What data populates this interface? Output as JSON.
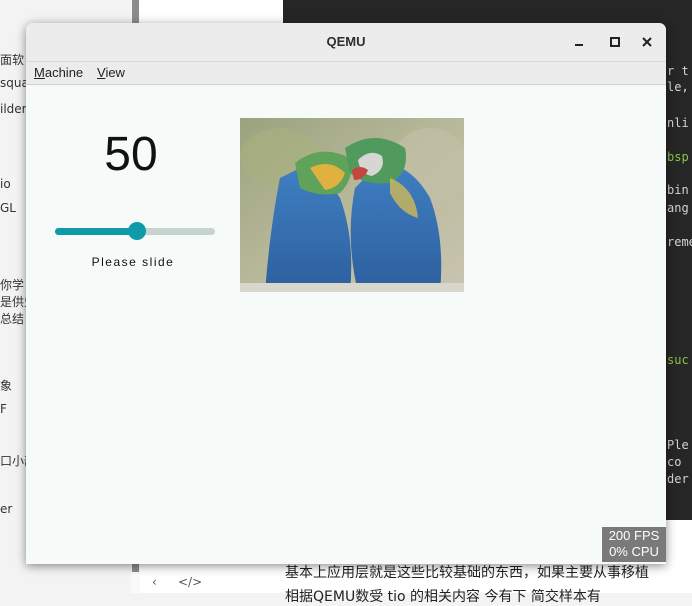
{
  "window": {
    "title": "QEMU",
    "menu": [
      {
        "label_accel": "M",
        "label_rest": "achine"
      },
      {
        "label_accel": "V",
        "label_rest": "iew"
      }
    ]
  },
  "app": {
    "slider_value": "50",
    "slider_fraction": 0.5,
    "slider_caption": "Please slide",
    "image_subject": "two-macaw-parrots"
  },
  "overlay": {
    "fps": "200 FPS",
    "cpu": "0% CPU"
  },
  "colors": {
    "accent": "#0f9aa8",
    "track": "#c7d3d0",
    "window_bg": "#f6faf9"
  },
  "background": {
    "left_fragments": [
      "面软",
      "squa",
      "ilder",
      "io",
      "GL",
      "你学",
      "是供史",
      "总结",
      "象",
      "F",
      "口小部",
      "er"
    ],
    "code_fragments": [
      "r t",
      "le,",
      "nli",
      "bsp",
      "bin",
      "ang",
      "reme",
      "suc",
      "Ple",
      " co",
      "der"
    ],
    "article_line1": "基本上应用层就是这些比较基础的东西，如果主要从事移植",
    "article_line2": "相据QEMU数受  tio 的相关内容  今有下  简交样本有"
  }
}
